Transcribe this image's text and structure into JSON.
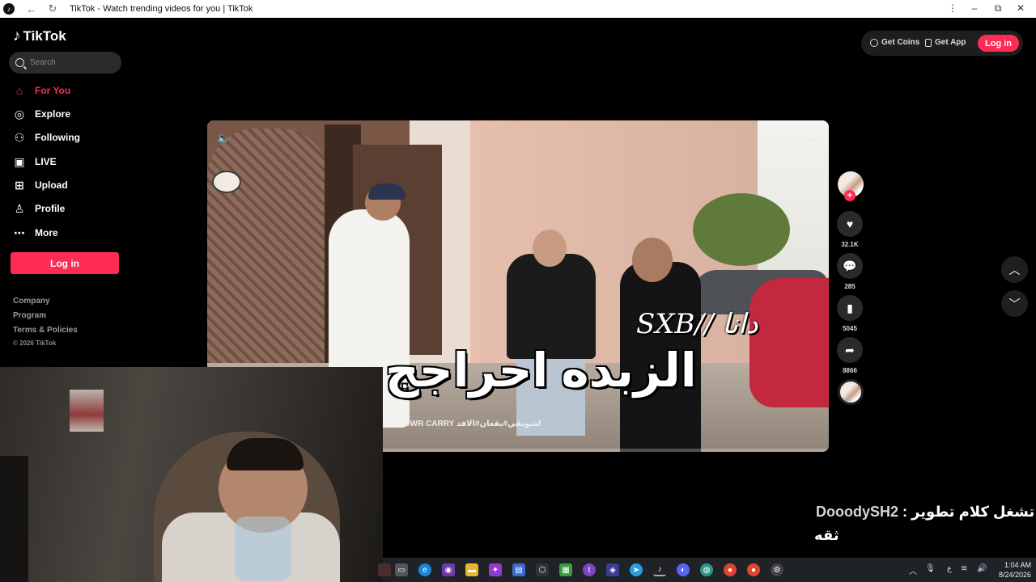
{
  "window": {
    "title": "TikTok - Watch trending videos for you | TikTok",
    "icons": [
      "tiktok-favicon",
      "back-arrow-icon",
      "reload-icon",
      "menu-dots-icon",
      "minimize-icon",
      "restore-icon",
      "close-icon"
    ]
  },
  "sidebar": {
    "logo": "TikTok",
    "search_placeholder": "Search",
    "items": [
      {
        "label": "For You",
        "icon": "home-icon",
        "active": true
      },
      {
        "label": "Explore",
        "icon": "compass-icon"
      },
      {
        "label": "Following",
        "icon": "following-icon"
      },
      {
        "label": "LIVE",
        "icon": "live-icon"
      },
      {
        "label": "Upload",
        "icon": "upload-icon"
      },
      {
        "label": "Profile",
        "icon": "profile-icon"
      },
      {
        "label": "More",
        "icon": "more-icon"
      }
    ],
    "login_label": "Log in",
    "footer": [
      "Company",
      "Program",
      "Terms & Policies"
    ],
    "copyright": "© 2026 TikTok"
  },
  "header": {
    "get_coins": "Get Coins",
    "get_app": "Get App",
    "login_label": "Log in"
  },
  "video": {
    "overlay_name": "SXB// دانا",
    "overlay_title": "الزبده احراجج",
    "caption": "@POWR Rayan @POWR CARRY لشونقي#بقعان#الافد",
    "icons": [
      "volume-icon",
      "more-options-icon"
    ]
  },
  "actions": {
    "likes": "32.1K",
    "comments": "285",
    "saves": "5045",
    "shares": "8866"
  },
  "chat": {
    "user": "DooodySH2",
    "message": "لا تشغل كلام تطوير",
    "message2": "ثقه"
  },
  "taskbar": {
    "time": "1:04 AM",
    "date": "8/24/2026",
    "lang": "ع"
  },
  "colors": {
    "accent": "#fe2c55",
    "background": "#000000",
    "surface": "#2b2b2b"
  }
}
